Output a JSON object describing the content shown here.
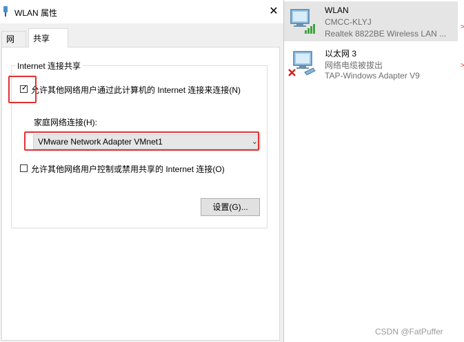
{
  "dialog": {
    "title": "WLAN 属性",
    "close_symbol": "✕",
    "tabs": [
      {
        "label": "网络"
      },
      {
        "label": "共享",
        "active": true
      }
    ],
    "group_title": "Internet 连接共享",
    "allow_share": {
      "label": "允许其他网络用户通过此计算机的 Internet 连接来连接(N)",
      "checked": true
    },
    "home_network_label": "家庭网络连接(H):",
    "home_network_value": "VMware Network Adapter VMnet1",
    "allow_control": {
      "label": "允许其他网络用户控制或禁用共享的 Internet 连接(O)",
      "checked": false
    },
    "settings_button": "设置(G)..."
  },
  "connections": [
    {
      "name": "WLAN",
      "status": "CMCC-KLYJ",
      "adapter": "Realtek 8822BE Wireless LAN ...",
      "icon": "wifi-adapter-icon",
      "selected": true
    },
    {
      "name": "以太网 3",
      "status": "网络电缆被拔出",
      "adapter": "TAP-Windows Adapter V9",
      "icon": "ethernet-disconnected-icon",
      "selected": false
    }
  ],
  "watermark": "CSDN @FatPuffer",
  "colors": {
    "annotation": "#e03131",
    "selected_row": "#e5e5e5",
    "panel": "#ffffff",
    "dialog_bg": "#f0f0f0"
  }
}
